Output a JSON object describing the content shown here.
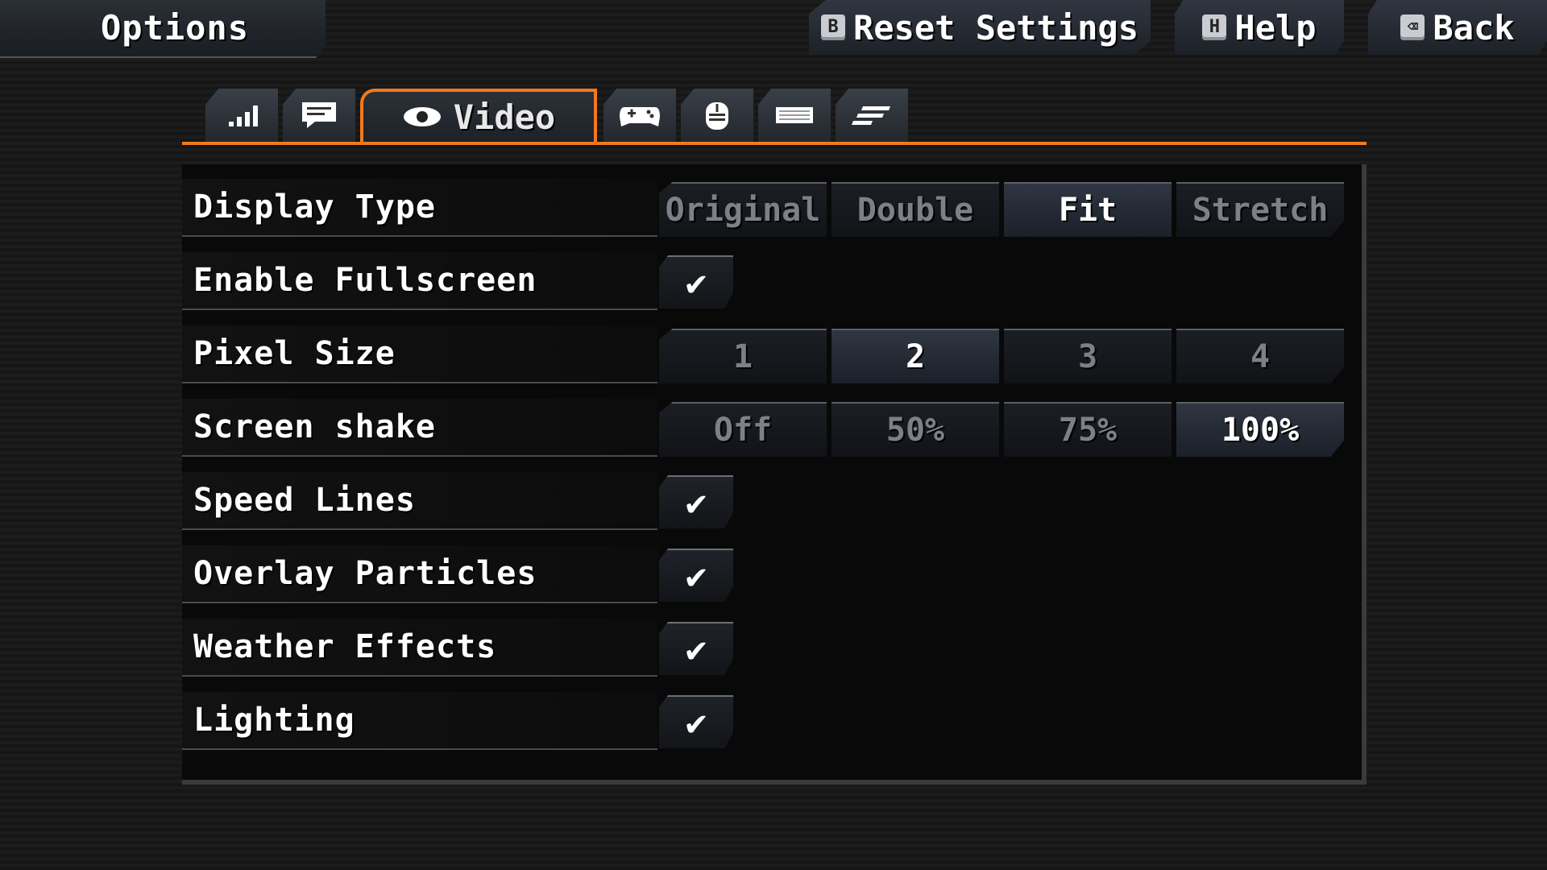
{
  "header": {
    "title": "Options",
    "reset": {
      "key": "B",
      "label": "Reset Settings"
    },
    "help": {
      "key": "H",
      "label": "Help"
    },
    "back": {
      "key": "⌫",
      "label": "Back"
    }
  },
  "tabs": {
    "active_label": "Video",
    "icons": [
      "signal-bars-icon",
      "chat-icon",
      "eye-icon",
      "gamepad-icon",
      "mouse-icon",
      "keyboard-icon",
      "lines-icon"
    ]
  },
  "settings": {
    "display_type": {
      "label": "Display Type",
      "options": [
        "Original",
        "Double",
        "Fit",
        "Stretch"
      ],
      "selected": "Fit"
    },
    "fullscreen": {
      "label": "Enable Fullscreen",
      "checked": true
    },
    "pixel_size": {
      "label": "Pixel Size",
      "options": [
        "1",
        "2",
        "3",
        "4"
      ],
      "selected": "2"
    },
    "screen_shake": {
      "label": "Screen shake",
      "options": [
        "Off",
        "50%",
        "75%",
        "100%"
      ],
      "selected": "100%"
    },
    "speed_lines": {
      "label": "Speed Lines",
      "checked": true
    },
    "overlay_particles": {
      "label": "Overlay Particles",
      "checked": true
    },
    "weather_effects": {
      "label": "Weather Effects",
      "checked": true
    },
    "lighting": {
      "label": "Lighting",
      "checked": true
    }
  },
  "colors": {
    "accent": "#f07a1c",
    "selected_bg": "#2f3642",
    "unselected_text": "#7d8187"
  }
}
